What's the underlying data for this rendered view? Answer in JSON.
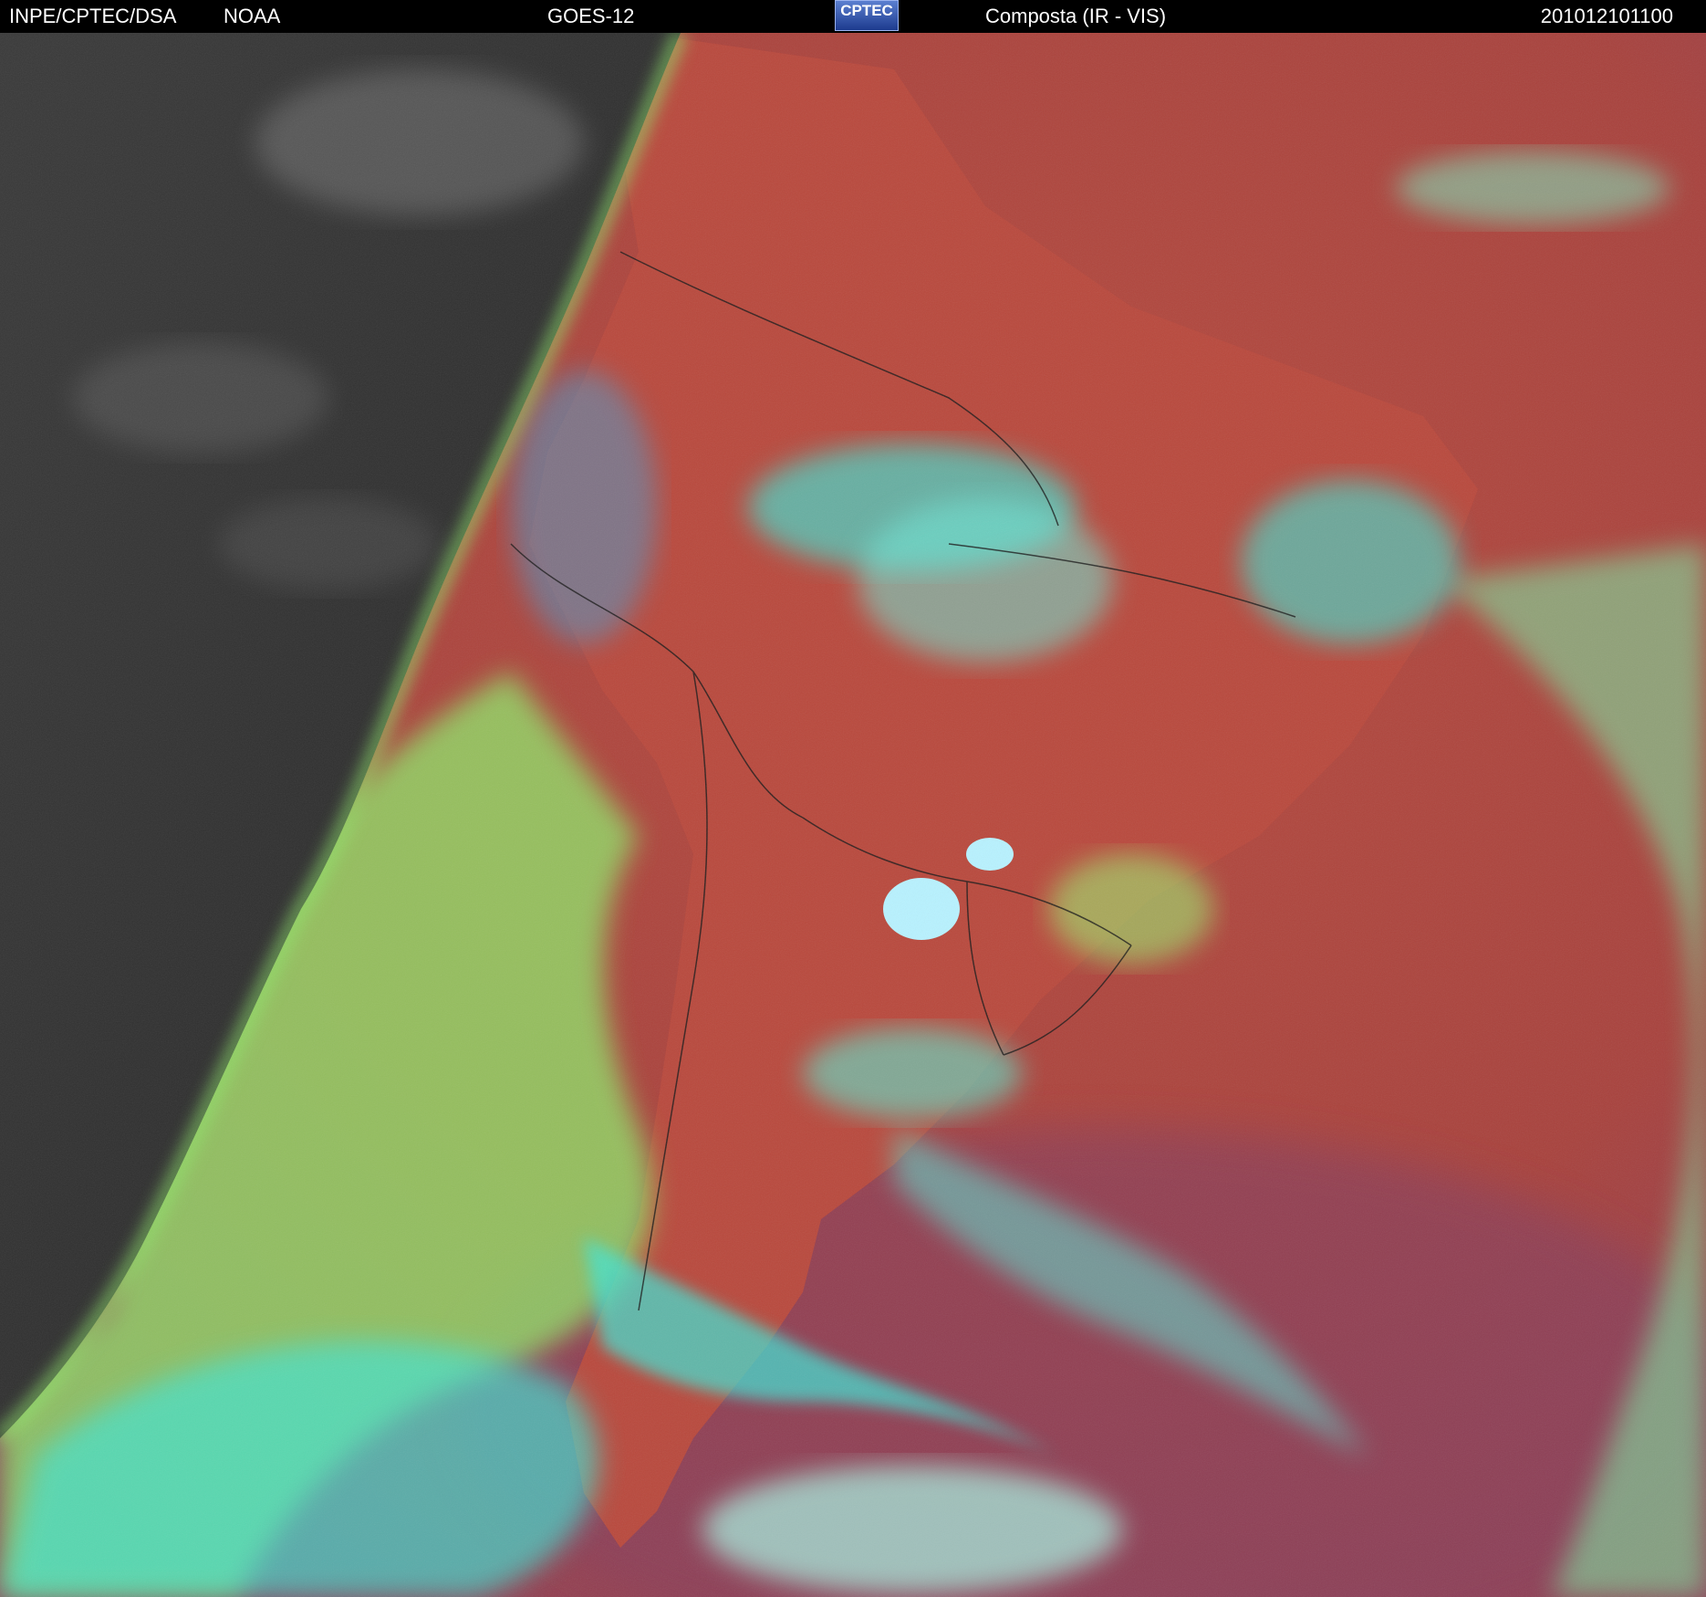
{
  "header": {
    "org": "INPE/CPTEC/DSA",
    "agency": "NOAA",
    "satellite": "GOES-12",
    "logo_text": "CPTEC",
    "product": "Composta (IR - VIS)",
    "timestamp": "201012101100"
  },
  "colors": {
    "background": "#000000",
    "night_side": "#2a2a2a",
    "land_red": "#b84a3f",
    "ocean_red": "#a8423d",
    "ocean_purple": "#8a3f5a",
    "cloud_cyan": "#3ee6d8",
    "cloud_green": "#8fe86a",
    "cloud_light_blue": "#b8f2ff",
    "border_line": "#1a1a1a"
  },
  "icons": {
    "logo": "cptec-logo"
  }
}
